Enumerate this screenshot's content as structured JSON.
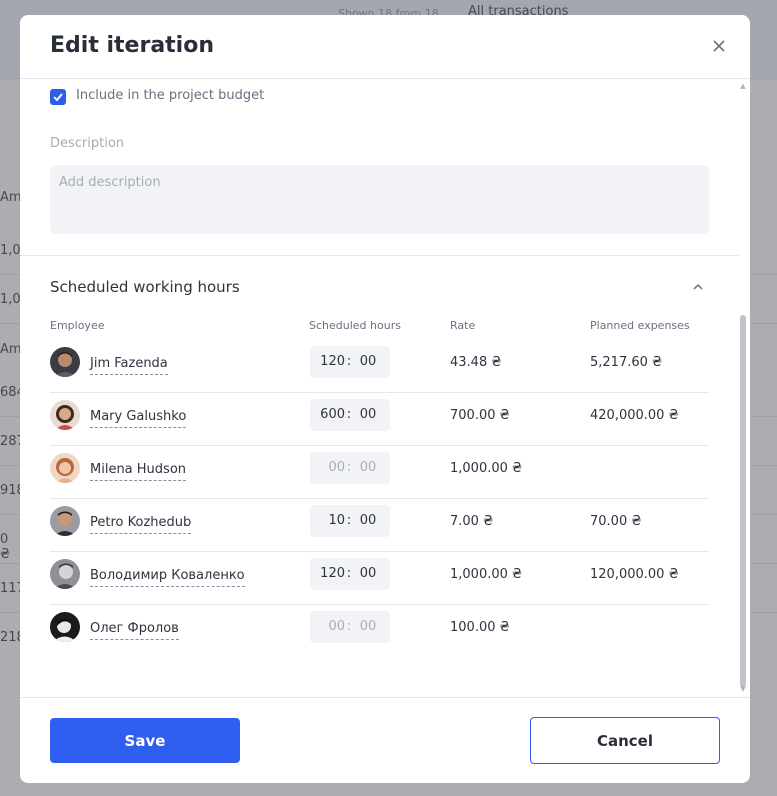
{
  "background": {
    "header_count": "Shown 18 from 18",
    "header_tab": "All transactions",
    "row_fragments": [
      "Amo",
      "1,00",
      "1,00",
      "Amo",
      "684",
      "287",
      "918",
      "0 ₴",
      "1175",
      "218"
    ]
  },
  "modal": {
    "title": "Edit iteration",
    "close_icon": "close-icon",
    "include_budget": {
      "label": "Include in the project budget",
      "checked": true
    },
    "description": {
      "label": "Description",
      "placeholder": "Add description",
      "value": ""
    },
    "section": {
      "title": "Scheduled working hours",
      "toggle_icon": "chevron-up-icon"
    },
    "columns": {
      "employee": "Employee",
      "scheduled_hours": "Scheduled hours",
      "rate": "Rate",
      "planned_expenses": "Planned expenses"
    },
    "employees": [
      {
        "name": "Jim Fazenda",
        "hours": "120",
        "minutes": "00",
        "empty": false,
        "rate": "43.48 ₴",
        "planned": "5,217.60 ₴"
      },
      {
        "name": "Mary Galushko",
        "hours": "600",
        "minutes": "00",
        "empty": false,
        "rate": "700.00 ₴",
        "planned": "420,000.00 ₴"
      },
      {
        "name": "Milena Hudson",
        "hours": "00",
        "minutes": "00",
        "empty": true,
        "rate": "1,000.00 ₴",
        "planned": ""
      },
      {
        "name": "Petro Kozhedub",
        "hours": "10",
        "minutes": "00",
        "empty": false,
        "rate": "7.00 ₴",
        "planned": "70.00 ₴"
      },
      {
        "name": "Володимир Коваленко",
        "hours": "120",
        "minutes": "00",
        "empty": false,
        "rate": "1,000.00 ₴",
        "planned": "120,000.00 ₴"
      },
      {
        "name": "Олег Фролов",
        "hours": "00",
        "minutes": "00",
        "empty": true,
        "rate": "100.00 ₴",
        "planned": ""
      }
    ],
    "footer": {
      "save_label": "Save",
      "cancel_label": "Cancel"
    },
    "colors": {
      "primary": "#2f5ff0",
      "checkbox": "#2f5de8",
      "input_bg": "#f2f3f7",
      "overlay": "rgba(90,92,102,0.5)"
    }
  }
}
